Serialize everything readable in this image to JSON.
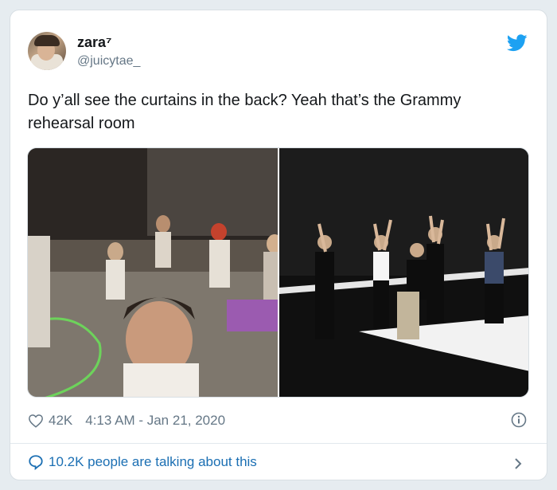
{
  "user": {
    "name": "zara⁷",
    "handle": "@juicytae_"
  },
  "tweet": {
    "text": "Do y’all see the curtains in the back? Yeah that’s the Grammy rehearsal room"
  },
  "meta": {
    "likes": "42K",
    "timestamp": "4:13 AM - Jan 21, 2020"
  },
  "footer": {
    "talking": "10.2K people are talking about this"
  },
  "icons": {
    "brand": "twitter-bird-icon",
    "like": "heart-icon",
    "info": "info-icon",
    "comment": "speech-bubble-icon",
    "more": "chevron-right-icon"
  },
  "colors": {
    "twitter_blue": "#1da1f2",
    "link_blue": "#1b6fb3",
    "muted": "#657786"
  }
}
